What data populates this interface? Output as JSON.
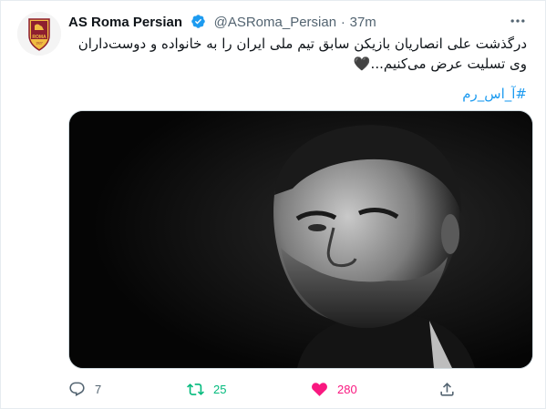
{
  "tweet": {
    "display_name": "AS Roma Persian",
    "handle": "@ASRoma_Persian",
    "separator": "·",
    "time": "37m",
    "text": "درگذشت علی انصاریان بازیکن سابق تیم ملی ایران را به خانواده و دوست‌داران وی تسلیت عرض می‌کنیم...🖤",
    "hashtag": "#آ_اس_رم",
    "avatar_badge_text": "ROMA",
    "avatar_badge_year": "1927"
  },
  "actions": {
    "replies": "7",
    "retweets": "25",
    "likes": "280"
  },
  "colors": {
    "accent": "#1d9bf0",
    "retweet": "#00ba7c",
    "like": "#f91880",
    "muted": "#536471",
    "roma_red": "#8e1f2f",
    "roma_yellow": "#f0bc42"
  },
  "icons": [
    "verified-badge-icon",
    "more-options-icon",
    "reply-icon",
    "retweet-icon",
    "like-heart-icon",
    "share-icon"
  ]
}
